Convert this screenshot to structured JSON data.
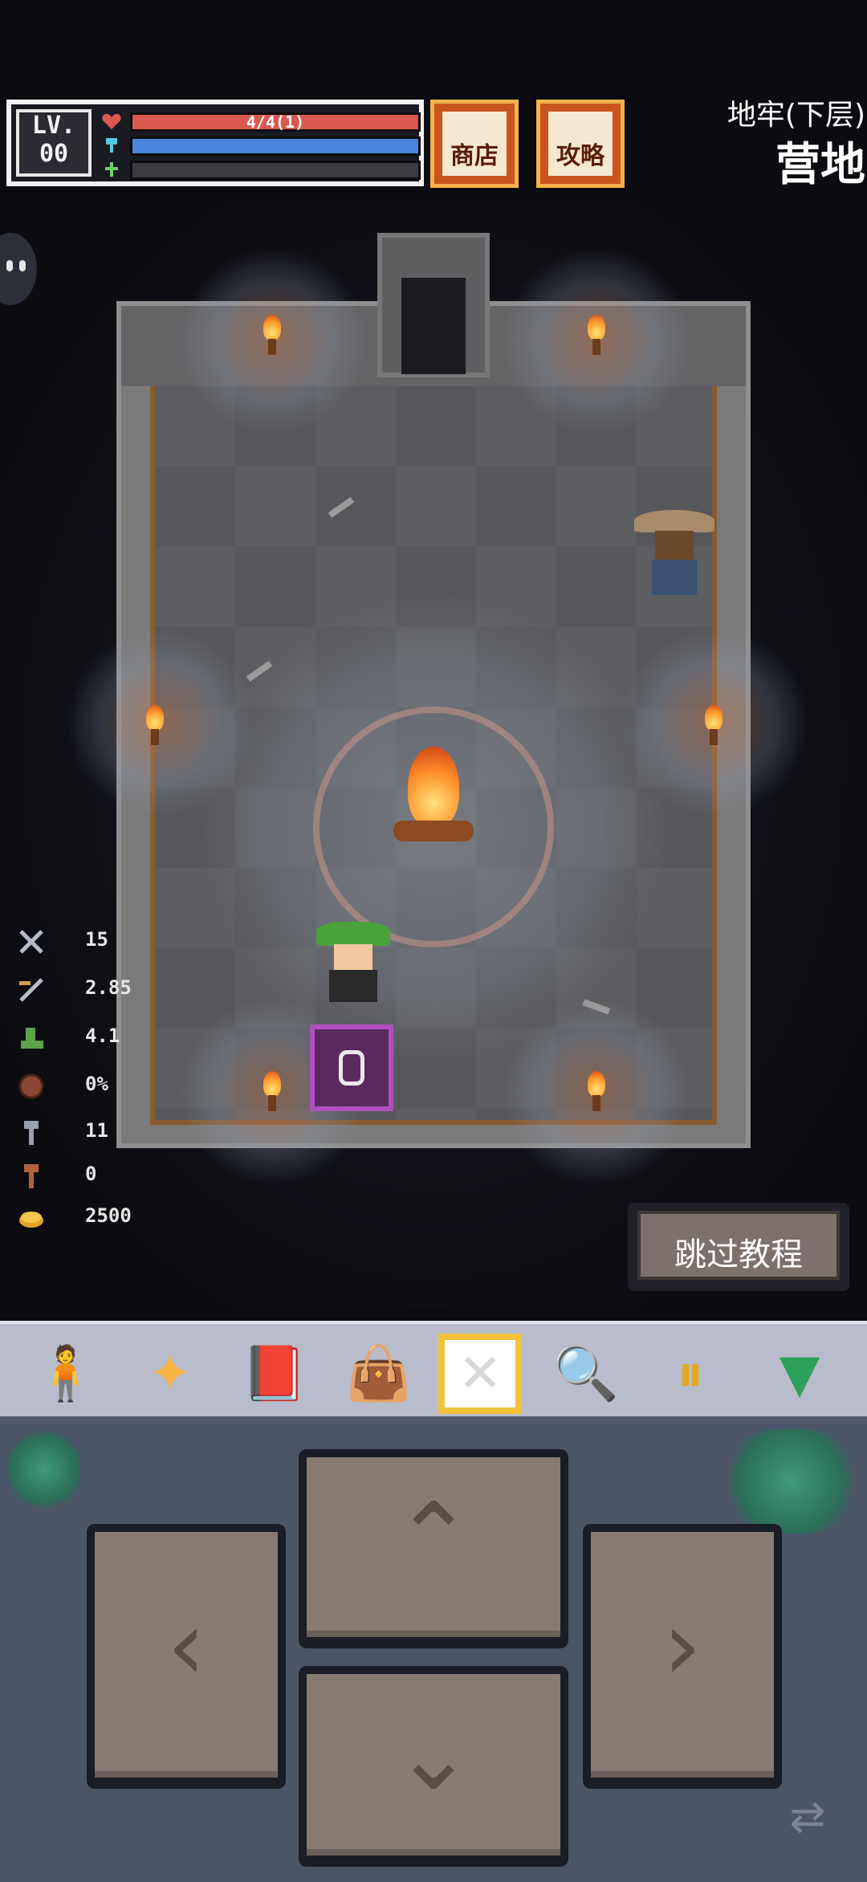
{
  "hud": {
    "level_label": "LV.",
    "level_value": "00",
    "hp_text": "4/4(1)",
    "hp_fill": 1.0,
    "mp_fill": 1.0,
    "xp_fill": 0.0,
    "shop_label": "商店",
    "guide_label": "攻略"
  },
  "location": {
    "area": "地牢(下层)",
    "name": "营地"
  },
  "stats": [
    {
      "icon": "sword-icon",
      "value": "15"
    },
    {
      "icon": "attack-speed-icon",
      "value": "2.85"
    },
    {
      "icon": "boot-icon",
      "value": "4.1"
    },
    {
      "icon": "shield-icon",
      "value": "0%"
    },
    {
      "icon": "key-icon",
      "value": "11"
    },
    {
      "icon": "bronze-key-icon",
      "value": "0"
    },
    {
      "icon": "gold-icon",
      "value": "2500"
    }
  ],
  "skip_button": {
    "label": "跳过教程"
  },
  "toolbar": [
    {
      "icon": "character-icon",
      "symbol": "🧍",
      "color": "#3c8fe0"
    },
    {
      "icon": "skill-sparkle-icon",
      "symbol": "✦",
      "color": "#f5b440"
    },
    {
      "icon": "book-icon",
      "symbol": "📕",
      "color": "#a0463a"
    },
    {
      "icon": "bag-icon",
      "symbol": "👜",
      "color": "#8a3f2e"
    },
    {
      "icon": "selection-target-icon",
      "symbol": "✕",
      "color": "#d8d8d8"
    },
    {
      "icon": "search-icon",
      "symbol": "🔍",
      "color": "#b3552b"
    },
    {
      "icon": "pause-icon",
      "symbol": "⏸",
      "color": "#e0a823"
    },
    {
      "icon": "collapse-triangle-icon",
      "symbol": "▼",
      "color": "#2ea05a"
    }
  ],
  "dpad": {
    "up": "⌃",
    "down": "⌄",
    "left": "‹",
    "right": "›",
    "swap": "⇄"
  },
  "colors": {
    "hp": "#d9584f",
    "mp": "#4a86db",
    "accent_gold": "#f1c23a"
  }
}
